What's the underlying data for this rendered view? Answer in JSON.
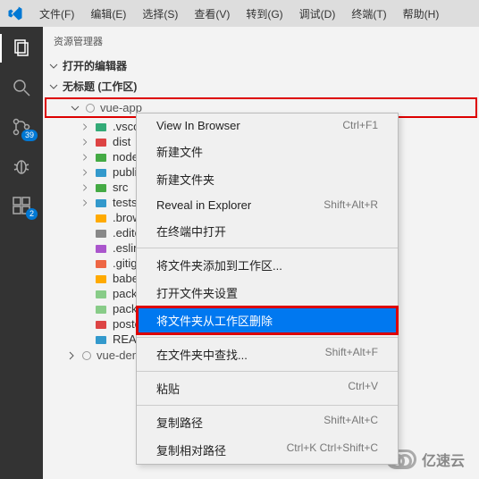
{
  "menubar": [
    "文件(F)",
    "编辑(E)",
    "选择(S)",
    "查看(V)",
    "转到(G)",
    "调试(D)",
    "终端(T)",
    "帮助(H)"
  ],
  "activity": {
    "items": [
      {
        "name": "files-icon",
        "badge": null,
        "active": true
      },
      {
        "name": "search-icon",
        "badge": null
      },
      {
        "name": "git-icon",
        "badge": "39"
      },
      {
        "name": "bug-icon",
        "badge": null
      },
      {
        "name": "extensions-icon",
        "badge": "2"
      }
    ]
  },
  "explorer": {
    "title": "资源管理器",
    "sections": {
      "open_editors": "打开的编辑器",
      "workspace": "无标题 (工作区)"
    },
    "root": "vue-app",
    "tree": [
      {
        "name": ".vscod",
        "icon": "folder-blue",
        "chev": true,
        "color": "#3a7"
      },
      {
        "name": "dist",
        "icon": "folder-red",
        "chev": true,
        "color": "#d44"
      },
      {
        "name": "node_",
        "icon": "folder-green",
        "chev": true,
        "color": "#4a4"
      },
      {
        "name": "public",
        "icon": "folder-blue",
        "chev": true,
        "color": "#39c"
      },
      {
        "name": "src",
        "icon": "folder-green",
        "chev": true,
        "color": "#4a4"
      },
      {
        "name": "tests",
        "icon": "folder-blue",
        "chev": true,
        "color": "#39c"
      },
      {
        "name": ".brow",
        "icon": "file-yellow",
        "chev": false,
        "color": "#fa0"
      },
      {
        "name": ".edito",
        "icon": "file-gear",
        "chev": false,
        "color": "#888"
      },
      {
        "name": ".eslint",
        "icon": "file-purple",
        "chev": false,
        "color": "#a5c"
      },
      {
        "name": ".gitigi",
        "icon": "file-orange",
        "chev": false,
        "color": "#e64"
      },
      {
        "name": "babel",
        "icon": "file-babel",
        "chev": false,
        "color": "#fa0"
      },
      {
        "name": "packa",
        "icon": "file-pkg",
        "chev": false,
        "color": "#8c8"
      },
      {
        "name": "packa",
        "icon": "file-pkg",
        "chev": false,
        "color": "#8c8"
      },
      {
        "name": "postc",
        "icon": "file-post",
        "chev": false,
        "color": "#d44"
      },
      {
        "name": "READ",
        "icon": "file-info",
        "chev": false,
        "color": "#39c"
      }
    ],
    "sibling": "vue-demo"
  },
  "context_menu": [
    {
      "label": "View In Browser",
      "shortcut": "Ctrl+F1"
    },
    {
      "label": "新建文件"
    },
    {
      "label": "新建文件夹"
    },
    {
      "label": "Reveal in Explorer",
      "shortcut": "Shift+Alt+R"
    },
    {
      "label": "在终端中打开"
    },
    {
      "sep": true
    },
    {
      "label": "将文件夹添加到工作区..."
    },
    {
      "label": "打开文件夹设置"
    },
    {
      "label": "将文件夹从工作区删除",
      "selected": true
    },
    {
      "sep": true
    },
    {
      "label": "在文件夹中查找...",
      "shortcut": "Shift+Alt+F"
    },
    {
      "sep": true
    },
    {
      "label": "粘贴",
      "shortcut": "Ctrl+V"
    },
    {
      "sep": true
    },
    {
      "label": "复制路径",
      "shortcut": "Shift+Alt+C"
    },
    {
      "label": "复制相对路径",
      "shortcut": "Ctrl+K Ctrl+Shift+C"
    }
  ],
  "logo": "亿速云"
}
